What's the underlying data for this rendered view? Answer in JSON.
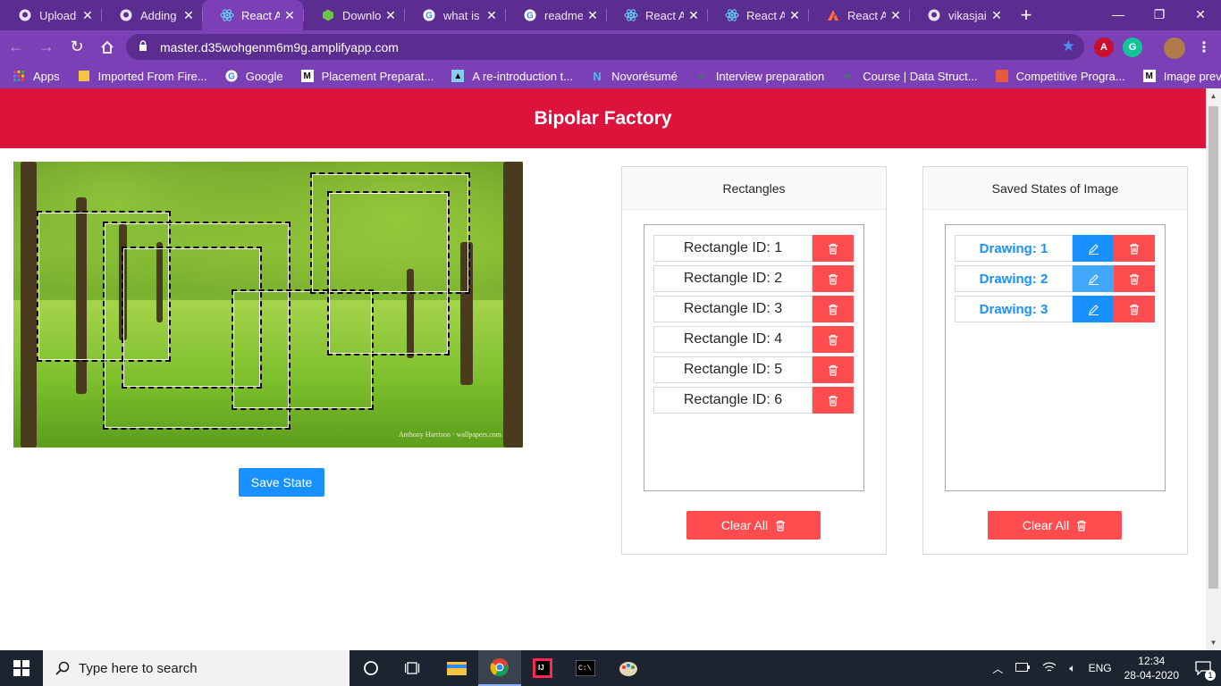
{
  "browser": {
    "tabs": [
      {
        "title": "Upload fi",
        "icon": "github-icon"
      },
      {
        "title": "Adding a",
        "icon": "github-icon"
      },
      {
        "title": "React Ap",
        "icon": "react-icon"
      },
      {
        "title": "Downloa",
        "icon": "nodejs-icon"
      },
      {
        "title": "what is re",
        "icon": "google-icon"
      },
      {
        "title": "readme.r",
        "icon": "google-icon"
      },
      {
        "title": "React Ap",
        "icon": "react-icon"
      },
      {
        "title": "React Ap",
        "icon": "react-icon"
      },
      {
        "title": "React Ap",
        "icon": "amplify-icon"
      },
      {
        "title": "vikasjais/",
        "icon": "github-icon"
      }
    ],
    "active_tab_index": 2,
    "url": "master.d35wohgenm6m9g.amplifyapp.com",
    "bookmarks": [
      {
        "label": "Apps",
        "icon": "apps-grid-icon"
      },
      {
        "label": "Imported From Fire...",
        "icon": "folder-icon"
      },
      {
        "label": "Google",
        "icon": "google-icon"
      },
      {
        "label": "Placement Preparat...",
        "icon": "medium-icon"
      },
      {
        "label": "A re-introduction t...",
        "icon": "mdn-icon"
      },
      {
        "label": "Novorésumé",
        "icon": "novoresume-icon"
      },
      {
        "label": "Interview preparation",
        "icon": "geeksforgeeks-icon"
      },
      {
        "label": "Course | Data Struct...",
        "icon": "geeksforgeeks-icon"
      },
      {
        "label": "Competitive Progra...",
        "icon": "cube-icon"
      },
      {
        "label": "Image preview",
        "icon": "medium-icon"
      }
    ]
  },
  "app": {
    "title": "Bipolar Factory",
    "save_state_label": "Save State",
    "image_watermark": "Anthony Harrison · wallpapers.com",
    "rectangles_panel": {
      "title": "Rectangles",
      "items": [
        {
          "label": "Rectangle ID: 1"
        },
        {
          "label": "Rectangle ID: 2"
        },
        {
          "label": "Rectangle ID: 3"
        },
        {
          "label": "Rectangle ID: 4"
        },
        {
          "label": "Rectangle ID: 5"
        },
        {
          "label": "Rectangle ID: 6"
        }
      ],
      "clear_label": "Clear All"
    },
    "saved_panel": {
      "title": "Saved States of Image",
      "items": [
        {
          "label": "Drawing: 1"
        },
        {
          "label": "Drawing: 2"
        },
        {
          "label": "Drawing: 3"
        }
      ],
      "clear_label": "Clear All"
    },
    "colors": {
      "header": "#dc143c",
      "primary": "#1890ff",
      "danger": "#ff4d4f"
    }
  },
  "taskbar": {
    "search_placeholder": "Type here to search",
    "language": "ENG",
    "time": "12:34",
    "date": "28-04-2020",
    "notification_count": "1"
  }
}
